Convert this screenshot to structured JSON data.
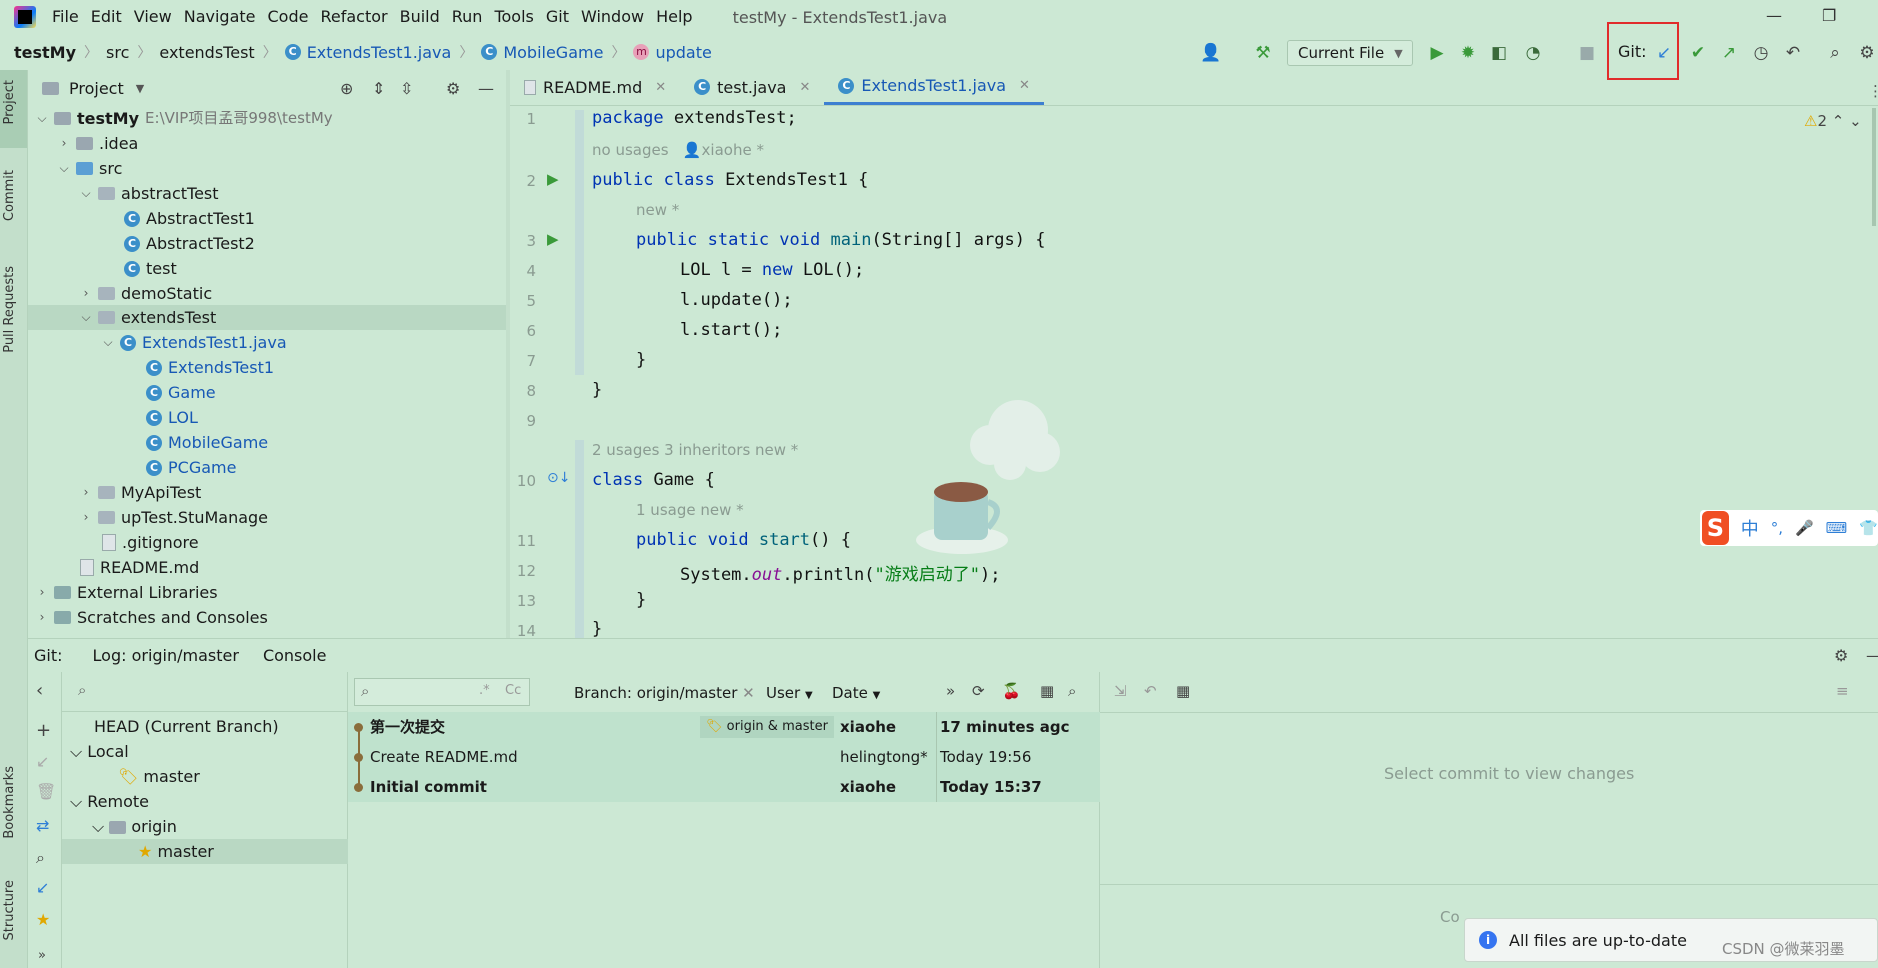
{
  "menubar": {
    "items": [
      "File",
      "Edit",
      "View",
      "Navigate",
      "Code",
      "Refactor",
      "Build",
      "Run",
      "Tools",
      "Git",
      "Window",
      "Help"
    ],
    "title": "testMy - ExtendsTest1.java"
  },
  "navbar": {
    "crumbs": [
      "testMy",
      "src",
      "extendsTest",
      "ExtendsTest1.java",
      "MobileGame",
      "update"
    ],
    "run_config": "Current File",
    "git_label": "Git:"
  },
  "project": {
    "header": "Project",
    "root_name": "testMy",
    "root_path": "E:\\VIP项目孟哥998\\testMy",
    "rows": [
      ".idea",
      "src",
      "abstractTest",
      "AbstractTest1",
      "AbstractTest2",
      "test",
      "demoStatic",
      "extendsTest",
      "ExtendsTest1.java",
      "ExtendsTest1",
      "Game",
      "LOL",
      "MobileGame",
      "PCGame",
      "MyApiTest",
      "upTest.StuManage",
      ".gitignore",
      "README.md",
      "External Libraries",
      "Scratches and Consoles"
    ]
  },
  "stripe": {
    "project": "Project",
    "commit": "Commit",
    "pull_requests": "Pull Requests",
    "bookmarks": "Bookmarks",
    "structure": "Structure"
  },
  "editor": {
    "tabs": [
      "README.md",
      "test.java",
      "ExtendsTest1.java"
    ],
    "warnings": "2",
    "lines": {
      "l1": [
        "package",
        "extendsTest;"
      ],
      "h1": "no usages",
      "h1b": "xiaohe *",
      "l2": [
        "public class",
        "ExtendsTest1 {"
      ],
      "h2": "new *",
      "l3": [
        "public static void",
        "main",
        "(String[] args) {"
      ],
      "l4": [
        "LOL l = ",
        "new",
        "LOL();"
      ],
      "l5": "l.update();",
      "l6": "l.start();",
      "l7": "}",
      "l8": "}",
      "h3": "2 usages   3 inheritors   new *",
      "l10": [
        "class",
        "Game {"
      ],
      "h4": "1 usage   new *",
      "l11": [
        "public void",
        "start",
        "() {"
      ],
      "l12": [
        "System.",
        "out",
        ".println(",
        "\"游戏启动了\"",
        ");"
      ],
      "l13": "}",
      "l14": "}"
    },
    "line_numbers": [
      "1",
      "2",
      "3",
      "4",
      "5",
      "6",
      "7",
      "8",
      "9",
      "10",
      "11",
      "12",
      "13",
      "14"
    ]
  },
  "bottom": {
    "git_label": "Git:",
    "tabs": [
      "Log: origin/master",
      "Console"
    ]
  },
  "branches": {
    "head": "HEAD (Current Branch)",
    "local": "Local",
    "local_master": "master",
    "remote": "Remote",
    "origin": "origin",
    "origin_master": "master"
  },
  "log": {
    "branch_filter": "Branch: origin/master",
    "user_filter": "User",
    "date_filter": "Date",
    "commits": [
      {
        "msg": "第一次提交",
        "refs": "origin & master",
        "author": "xiaohe",
        "date": "17 minutes agc",
        "bold": true
      },
      {
        "msg": "Create README.md",
        "refs": "",
        "author": "helingtong*",
        "date": "Today 19:56",
        "bold": false
      },
      {
        "msg": "Initial commit",
        "refs": "",
        "author": "xiaohe",
        "date": "Today 15:37",
        "bold": true
      }
    ]
  },
  "details": {
    "placeholder": "Select commit to view changes",
    "partial": "Co"
  },
  "notification": {
    "text": "All files are up-to-date"
  },
  "watermark": "CSDN @微莱羽墨",
  "ime": {
    "chars": "中"
  }
}
